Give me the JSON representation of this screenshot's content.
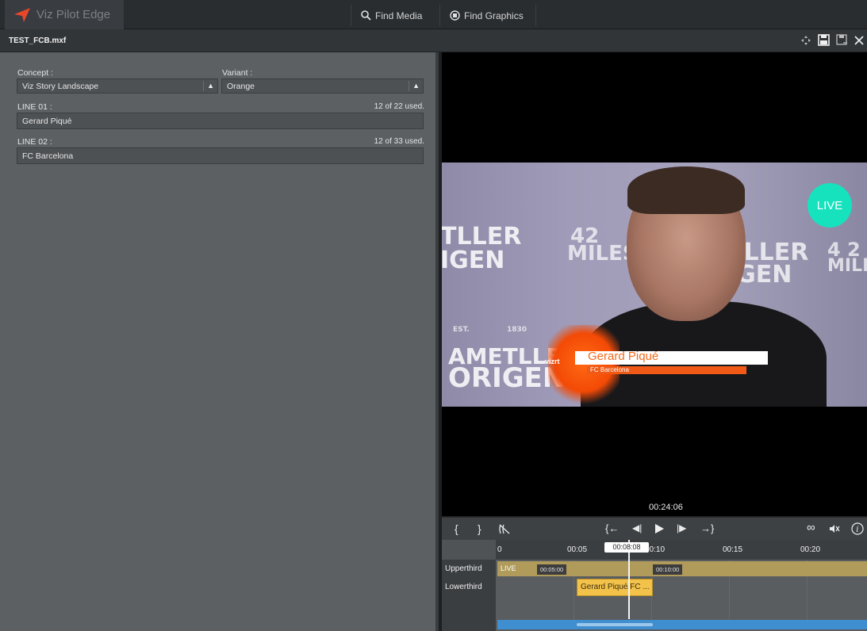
{
  "topbar": {
    "app_name": "Viz Pilot Edge",
    "brand_color": "#e8472a",
    "tabs": [
      {
        "label": "Find Media",
        "icon": "search-icon"
      },
      {
        "label": "Find Graphics",
        "icon": "graphics-icon"
      }
    ]
  },
  "titlebar": {
    "file_name": "TEST_FCB.mxf",
    "icons": [
      "move-icon",
      "save-icon",
      "save-as-icon",
      "close-icon"
    ]
  },
  "form": {
    "concept_label": "Concept :",
    "concept_value": "Viz Story Landscape",
    "variant_label": "Variant :",
    "variant_value": "Orange",
    "line1_label": "LINE 01 :",
    "line1_count": "12 of 22 used.",
    "line1_value": "Gerard Piqué",
    "line2_label": "LINE 02 :",
    "line2_count": "12 of 33 used.",
    "line2_value": "FC Barcelona"
  },
  "preview": {
    "live_badge": "LIVE",
    "lower_third_name": "Gerard Piqué",
    "lower_third_sub": "FC Barcelona",
    "lower_third_brand": "vizrt",
    "bg_text": [
      "AMETLLER",
      "ORIGEN",
      "EST.",
      "1830",
      "MILES",
      "TLLER",
      "IGEN",
      "42",
      "4 2"
    ],
    "timecode": "00:24:06"
  },
  "transport": {
    "buttons": [
      "mark-in-icon",
      "mark-out-icon",
      "clear-marks-icon",
      "go-to-in-icon",
      "step-back-icon",
      "play-icon",
      "step-forward-icon",
      "go-to-out-icon",
      "loop-icon",
      "mute-icon",
      "info-icon"
    ]
  },
  "timeline": {
    "ticks": [
      "0",
      "00:05",
      "00:10",
      "00:15",
      "00:20"
    ],
    "playhead_time": "00:08:08",
    "tracks": [
      "Upperthird",
      "Lowerthird"
    ],
    "upper_live": "LIVE",
    "upper_tag_1": "00:05:00",
    "upper_tag_2": "00:10:00",
    "lower_clip": "Gerard Piqué/FC ..."
  }
}
